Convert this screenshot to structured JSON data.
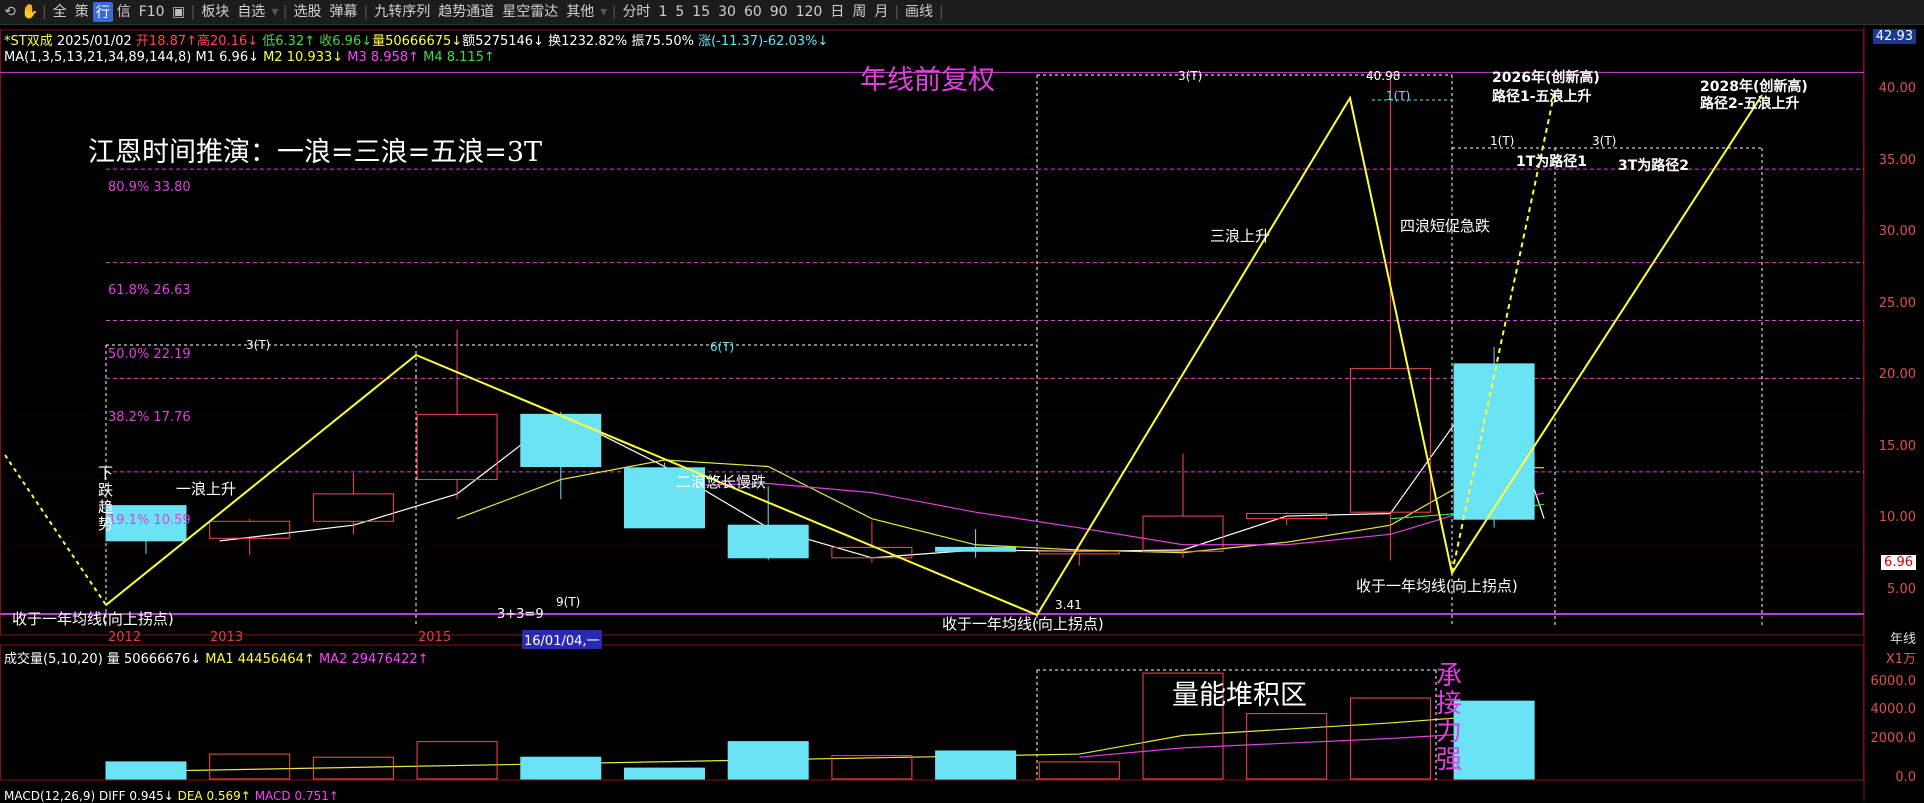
{
  "toolbar": {
    "items": [
      "全",
      "策",
      "信",
      "板块",
      "自选",
      "选股",
      "弹幕",
      "九转序列",
      "趋势通道",
      "星空雷达",
      "其他",
      "分时",
      "1",
      "5",
      "15",
      "30",
      "60",
      "90",
      "120",
      "日",
      "周",
      "月",
      "画线"
    ],
    "active_icon_label": "行",
    "f10_label": "F10"
  },
  "header": {
    "stock_name": "*ST双成",
    "date": "2025/01/02",
    "open": "开18.87↑",
    "high": "高20.16↓",
    "low": "低6.32↑",
    "close": "收6.96↓",
    "volume": "量50666675↓",
    "amount": "额5275146↓",
    "turnover": "换1232.82%",
    "amplitude": "振75.50%",
    "change": "涨(-11.37)-62.03%↓"
  },
  "ma": {
    "label": "MA(1,3,5,13,21,34,89,144,8)",
    "m1": "M1 6.96↓",
    "m2": "M2 10.933↓",
    "m3": "M3 8.958↑",
    "m4": "M4 8.115↑"
  },
  "volume_panel": {
    "label": "成交量(5,10,20)",
    "vol": "量 50666676↓",
    "ma1": "MA1 44456464↑",
    "ma2": "MA2 29476422↑",
    "unit": "X1万",
    "ticks": [
      "6000.0",
      "4000.0",
      "2000.0",
      "0.0"
    ]
  },
  "macd": {
    "label": "MACD(12,26,9)",
    "diff": "DIFF 0.945↓",
    "dea": "DEA 0.569↑",
    "macd": "MACD 0.751↑"
  },
  "price_axis": {
    "top": "42.93",
    "ticks": [
      "40.00",
      "35.00",
      "30.00",
      "25.00",
      "20.00",
      "15.00",
      "10.00",
      "5.00"
    ],
    "current": "6.96",
    "period": "年线"
  },
  "fib_levels": [
    "80.9% 33.80",
    "61.8% 26.63",
    "50.0% 22.19",
    "38.2% 17.76",
    "19.1% 10.59"
  ],
  "years": [
    "2012",
    "2013",
    "2015"
  ],
  "cursor_date": "16/01/04,一",
  "annotations": {
    "title": "年线前复权",
    "gann": "江恩时间推演：一浪=三浪=五浪=3T",
    "downtrend": "下跌趋势",
    "wave1": "一浪上升",
    "wave2": "二浪悠长慢跌",
    "wave3": "三浪上升",
    "wave4": "四浪短促急跌",
    "t3a": "3(T)",
    "t6": "6(T)",
    "t3b": "3(T)",
    "t1a": "1(T)",
    "t1b": "1(T)",
    "t3c": "3(T)",
    "t9": "9(T)",
    "calc": "3+3=9",
    "low_price": "3.41",
    "high_price": "40.98",
    "close_above1": "收于一年均线(向上拐点)",
    "close_above2": "收于一年均线(向上拐点)",
    "close_above3": "收于一年均线(向上拐点)",
    "path1_title": "2026年(创新高)",
    "path1_desc": "路径1-五浪上升",
    "path2_title": "2028年(创新高)",
    "path2_desc": "路径2-五浪上升",
    "path1_note": "1T为路径1",
    "path2_note": "3T为路径2",
    "vol_area": "量能堆积区",
    "support": [
      "承",
      "接",
      "力",
      "强"
    ]
  },
  "colors": {
    "up": "#ff4a4a",
    "down": "#6ae3f5",
    "wave": "#ffff3c",
    "ma_white": "#ffffff",
    "ma_yellow": "#e8e83c",
    "ma_magenta": "#e040e0",
    "fib": "#e040e0"
  },
  "chart_data": {
    "type": "candlestick",
    "period": "yearly",
    "ylim": [
      0,
      42.93
    ],
    "candles": [
      {
        "open": 8.0,
        "high": 8.0,
        "low": 4.3,
        "close": 5.3
      },
      {
        "open": 5.5,
        "high": 7.0,
        "low": 4.2,
        "close": 6.8
      },
      {
        "open": 6.8,
        "high": 10.5,
        "low": 5.8,
        "close": 8.9
      },
      {
        "open": 10.0,
        "high": 21.5,
        "low": 8.5,
        "close": 15.0
      },
      {
        "open": 15.0,
        "high": 15.2,
        "low": 8.5,
        "close": 11.0
      },
      {
        "open": 10.9,
        "high": 11.3,
        "low": 6.3,
        "close": 6.3
      },
      {
        "open": 6.5,
        "high": 9.5,
        "low": 3.8,
        "close": 4.0
      },
      {
        "open": 4.0,
        "high": 6.8,
        "low": 3.6,
        "close": 4.8
      },
      {
        "open": 4.8,
        "high": 6.2,
        "low": 4.0,
        "close": 4.5
      },
      {
        "open": 4.3,
        "high": 4.6,
        "low": 3.41,
        "close": 4.5
      },
      {
        "open": 4.5,
        "high": 12.0,
        "low": 4.0,
        "close": 7.2
      },
      {
        "open": 7.0,
        "high": 7.5,
        "low": 6.5,
        "close": 7.4
      },
      {
        "open": 7.5,
        "high": 40.98,
        "low": 3.8,
        "close": 18.5
      },
      {
        "open": 18.87,
        "high": 20.16,
        "low": 6.32,
        "close": 6.96
      }
    ],
    "volumes": [
      1100,
      1600,
      1400,
      2400,
      1400,
      700,
      2400,
      1500,
      1800,
      1100,
      6800,
      4200,
      5200,
      5000
    ]
  }
}
